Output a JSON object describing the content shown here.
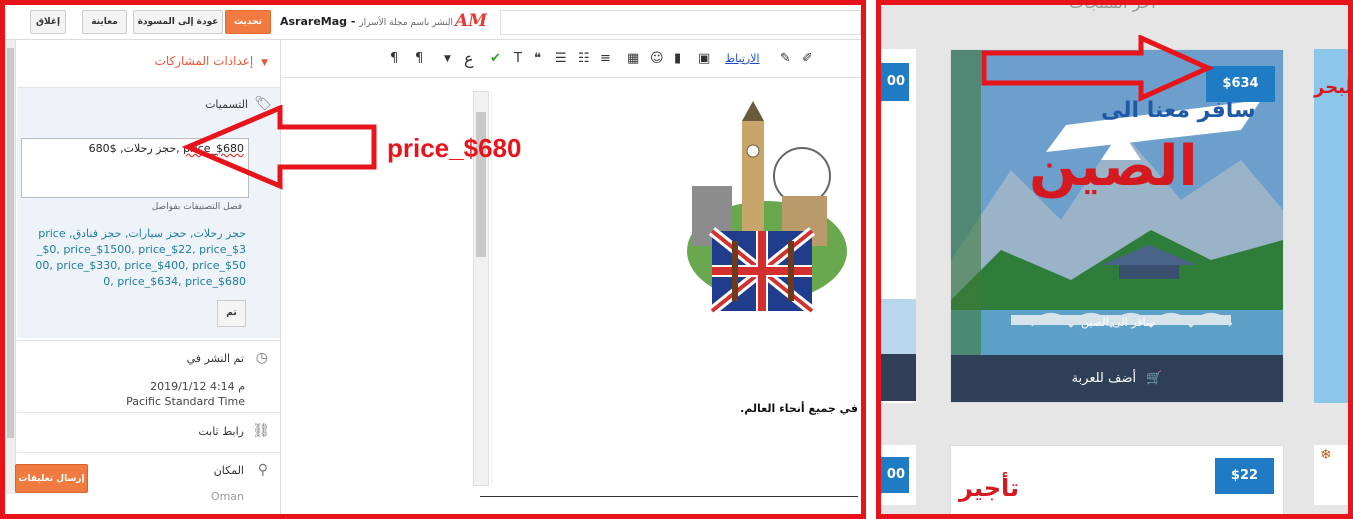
{
  "editor": {
    "buttons": {
      "close": "إغلاق",
      "preview": "معاينة",
      "revert_to_draft": "عودة إلى المسودة",
      "update": "تحديث"
    },
    "post_title": "AsrareMag -",
    "post_title_sub": "النشر باسم مجلة الأسرار",
    "logo": "AM",
    "sidebar": {
      "header": "إعدادات المشاركات",
      "labels_heading": "التسميات",
      "labels_value_prefix": "حجز رحلات",
      "labels_value_price": "price_$680",
      "labels_value_sep": ", ",
      "labels_value_price_plain": "$680",
      "labels_help": "فصل التصنيفات بفواصل",
      "labels_list": "حجز رحلات, حجز سيارات, حجز فنادق, price_$0, price_$1500, price_$22, price_$300, price_$330, price_$400, price_$500, price_$634, price_$680",
      "done_button": "تم",
      "published_heading": "تم النشر في",
      "published_date": "2019/1/12 4:14 م",
      "timezone": "Pacific Standard Time",
      "permalink_heading": "رابط ثابت",
      "location_heading": "المكان",
      "location_value": "Oman",
      "send_feedback": "إرسال تعليقات"
    },
    "toolbar": {
      "link_label": "الارتباط",
      "font_glyph": "ع"
    },
    "content_text": "في جميع أنحاء العالم."
  },
  "annotation": {
    "label": "price_$680"
  },
  "store": {
    "heading": "اخر المنتجات",
    "main_card": {
      "price": "$634",
      "add_to_cart": "أضف للعربة",
      "image_title_top": "سافر معنا الى",
      "image_title_main": "الصين",
      "image_caption": "سافر الى الصين"
    },
    "second_card": {
      "price": "$22",
      "image_text": "تأجير"
    },
    "left_badge_1": "00",
    "left_badge_2": "00",
    "right_snippet": "البحر"
  },
  "colors": {
    "frame_red": "#e8141b",
    "accent_orange": "#f07a3f",
    "badge_blue": "#1f7bc4",
    "cart_navy": "#2f3f57",
    "label_link": "#1c7d9b"
  }
}
